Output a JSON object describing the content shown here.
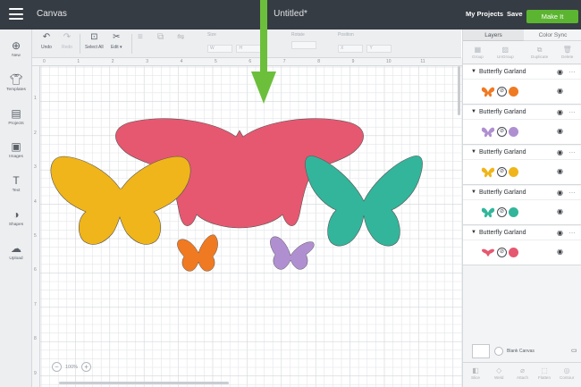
{
  "topbar": {
    "app_title": "Canvas",
    "doc_title": "Untitled*",
    "my_projects": "My Projects",
    "save": "Save",
    "make_it": "Make It"
  },
  "toolbar": {
    "undo": "Undo",
    "redo": "Redo",
    "select_all": "Select All",
    "edit": "Edit ▾",
    "groups": [
      {
        "label": "Size",
        "fields": [
          "W",
          "H"
        ]
      },
      {
        "label": "Rotate",
        "fields": [
          ""
        ]
      },
      {
        "label": "Position",
        "fields": [
          "X",
          "Y"
        ]
      }
    ]
  },
  "sidebar": {
    "items": [
      {
        "label": "New",
        "icon": "plus-circle-icon"
      },
      {
        "label": "Templates",
        "icon": "shirt-icon"
      },
      {
        "label": "Projects",
        "icon": "projects-icon"
      },
      {
        "label": "Images",
        "icon": "images-icon"
      },
      {
        "label": "Text",
        "icon": "text-icon"
      },
      {
        "label": "Shapes",
        "icon": "shapes-icon"
      },
      {
        "label": "Upload",
        "icon": "upload-icon"
      }
    ]
  },
  "canvas": {
    "ruler_top": [
      "0",
      "1",
      "2",
      "3",
      "4",
      "5",
      "6",
      "7",
      "8",
      "9",
      "10",
      "11"
    ],
    "ruler_left": [
      "1",
      "2",
      "3",
      "4",
      "5",
      "6",
      "7",
      "8",
      "9"
    ],
    "zoom": "100%",
    "colors": {
      "pink": "#e65870",
      "yellow": "#f0b51a",
      "teal": "#33b59b",
      "orange": "#f07a22",
      "purple": "#b08fd1",
      "grid": "#e3e6e9",
      "grid_major": "#d2d6da",
      "arrow": "#6cbf3b"
    }
  },
  "panel": {
    "tab_layers": "Layers",
    "tab_color_sync": "Color Sync",
    "tools": [
      "Group",
      "UnGroup",
      "Duplicate",
      "Delete"
    ],
    "bottom_tools": [
      "Slice",
      "Weld",
      "Attach",
      "Flatten",
      "Contour"
    ],
    "layers": [
      {
        "name": "Butterfly Garland",
        "color": "#f07a22"
      },
      {
        "name": "Butterfly Garland",
        "color": "#b08fd1"
      },
      {
        "name": "Butterfly Garland",
        "color": "#f0b51a"
      },
      {
        "name": "Butterfly Garland",
        "color": "#33b59b"
      },
      {
        "name": "Butterfly Garland",
        "color": "#e65870"
      }
    ],
    "blank_canvas": "Blank Canvas"
  }
}
